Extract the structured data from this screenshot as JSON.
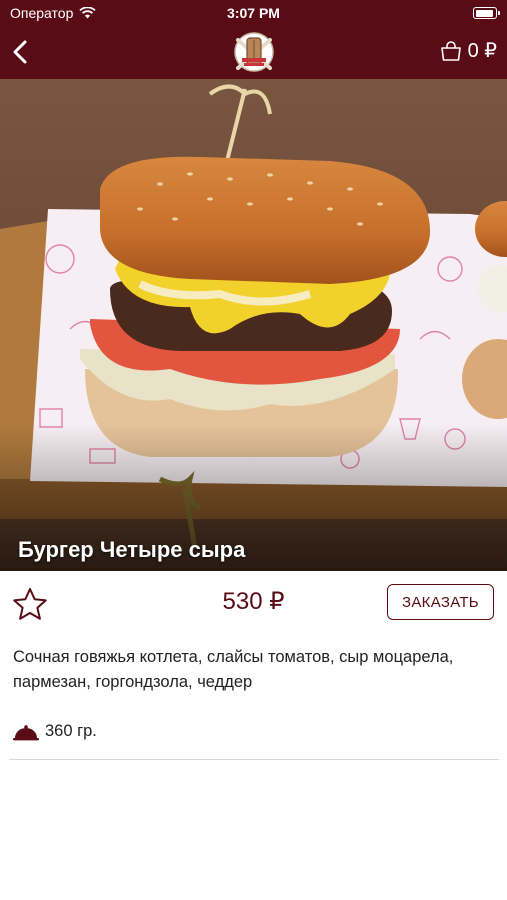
{
  "status_bar": {
    "carrier": "Оператор",
    "time": "3:07 PM"
  },
  "nav": {
    "cart_count": "0 ₽"
  },
  "product": {
    "title": "Бургер Четыре сыра",
    "price": "530 ₽",
    "order_label": "ЗАКАЗАТЬ",
    "description": "Сочная говяжья котлета, слайсы томатов, сыр моцарела, пармезан, горгондзола, чеддер",
    "weight": "360 гр."
  },
  "colors": {
    "brand": "#5a0c16",
    "text": "#222222",
    "divider": "#d9d9d9"
  },
  "icons": {
    "back": "chevron-left-icon",
    "cart": "shopping-bag-icon",
    "favorite": "star-outline-icon",
    "weight": "cloche-icon",
    "wifi": "wifi-icon",
    "battery": "battery-icon"
  }
}
